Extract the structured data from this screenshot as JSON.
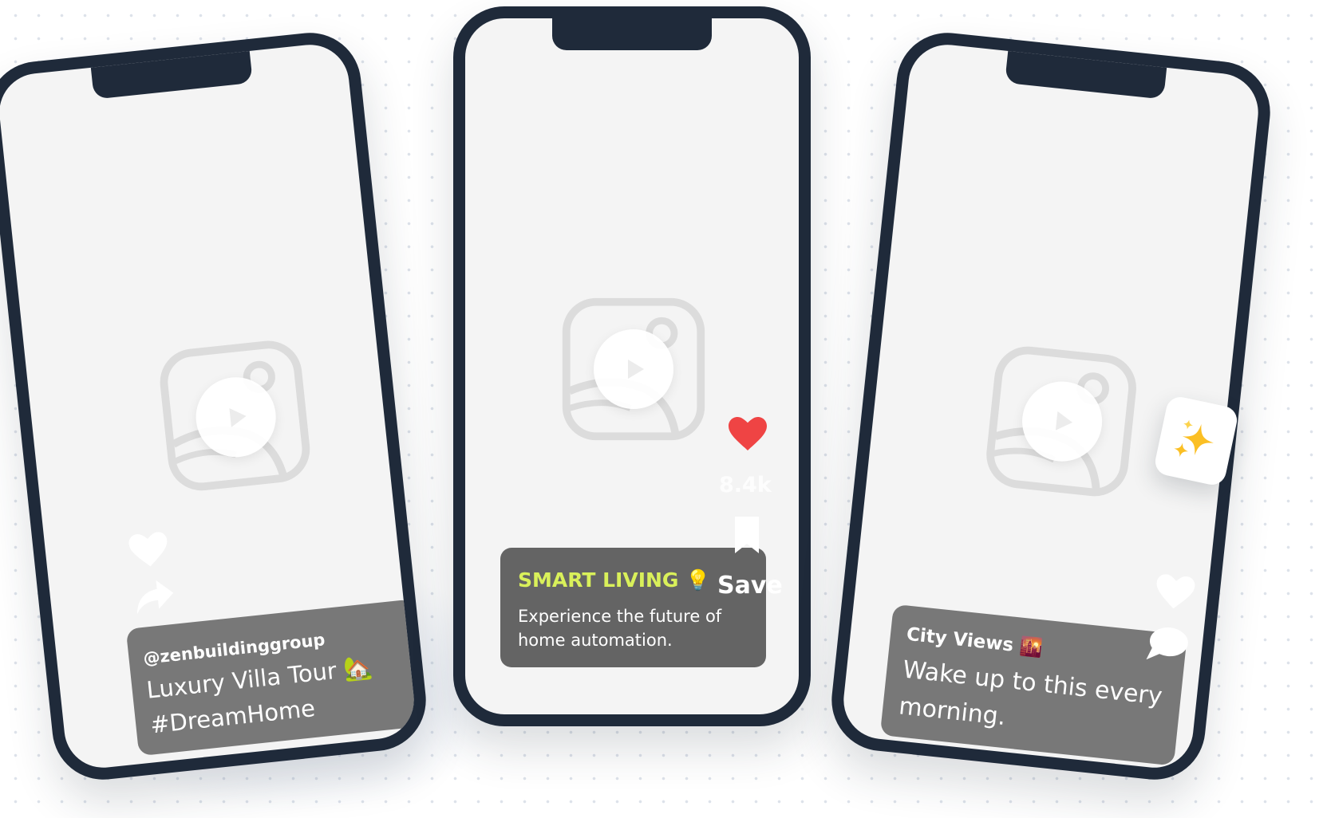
{
  "posts": [
    {
      "handle": "@zenbuildinggroup",
      "title": "Luxury Villa Tour 🏡 #DreamHome",
      "actions": [
        "heart-icon",
        "share-icon"
      ]
    },
    {
      "caption_title": "SMART LIVING 💡",
      "caption_text": "Experience the future of home automation.",
      "likes": "8.4k",
      "save_label": "Save",
      "actions": [
        "heart-icon",
        "bookmark-icon"
      ]
    },
    {
      "caption_title": "City Views 🌇",
      "caption_text": "Wake up to this every morning.",
      "actions": [
        "heart-icon",
        "chat-icon"
      ]
    }
  ],
  "badge": {
    "icon": "sparkles-icon",
    "emoji": "✨"
  },
  "colors": {
    "phone_frame": "#1f2a3a",
    "screen": "#f4f4f4",
    "accent_lime": "#d9f05a",
    "heart_red": "#ef4444",
    "caption_bg": "#5a5a5a"
  }
}
